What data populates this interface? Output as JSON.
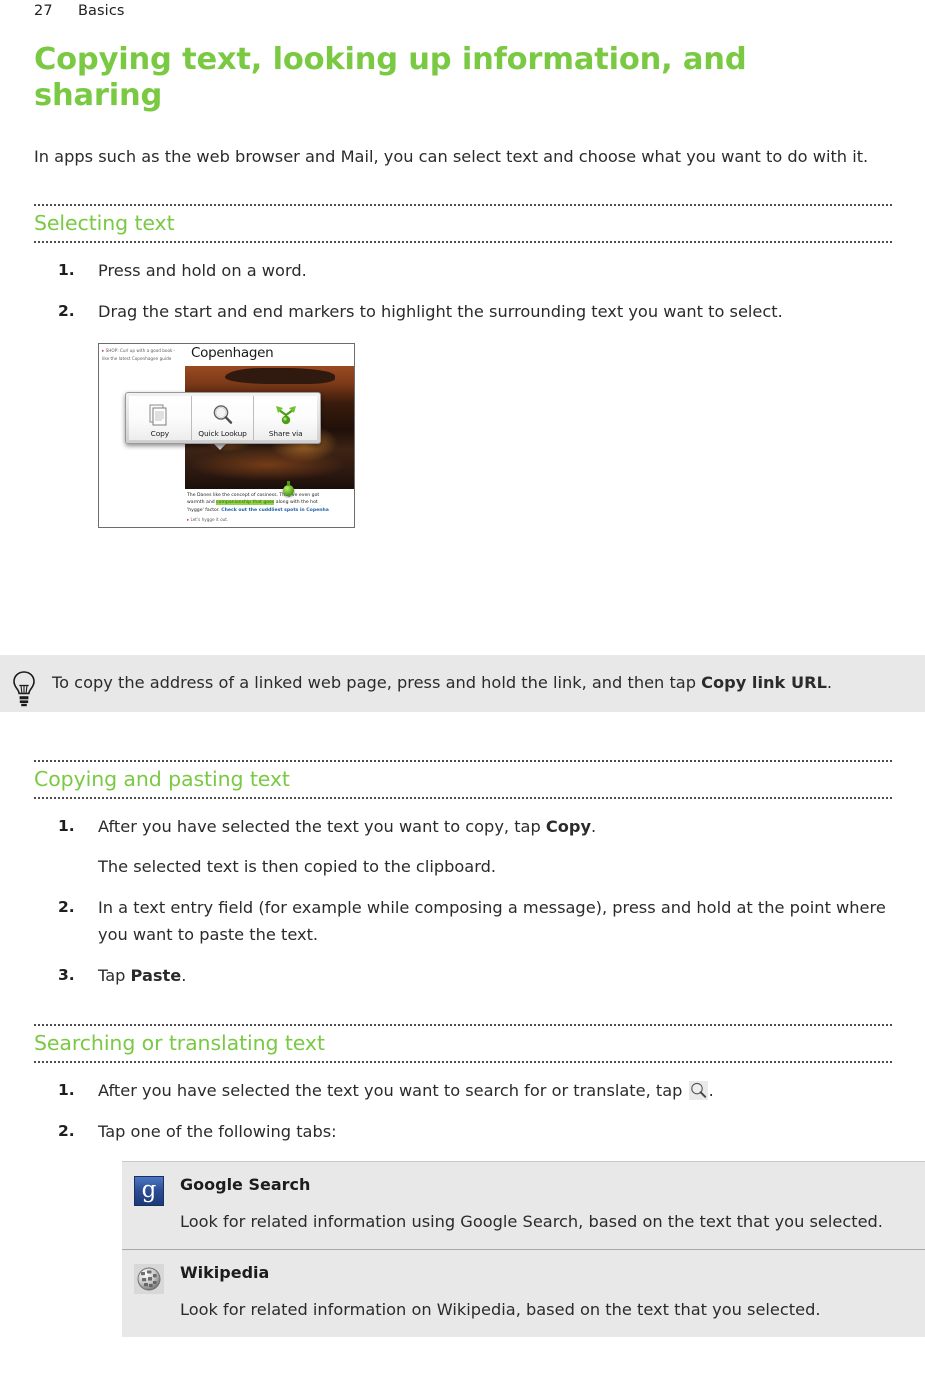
{
  "header": {
    "page_number": "27",
    "section": "Basics"
  },
  "chapter": {
    "title": "Copying text, looking up information, and sharing",
    "intro": "In apps such as the web browser and Mail, you can select text and choose what you want to do with it."
  },
  "sections": [
    {
      "id": "selecting-text",
      "title": "Selecting text",
      "steps": [
        {
          "number": "1.",
          "text": "Press and hold on a word."
        },
        {
          "number": "2.",
          "text": "Drag the start and end markers to highlight the surrounding text you want to select."
        }
      ]
    },
    {
      "id": "copying-pasting",
      "title": "Copying and pasting text",
      "steps": [
        {
          "number": "1.",
          "text_before": "After you have selected the text you want to copy, tap ",
          "bold": "Copy",
          "text_after": ".",
          "sub_note": "The selected text is then copied to the clipboard."
        },
        {
          "number": "2.",
          "text": "In a text entry field (for example while composing a message), press and hold at the point where you want to paste the text."
        },
        {
          "number": "3.",
          "text_before": "Tap ",
          "bold": "Paste",
          "text_after": "."
        }
      ]
    },
    {
      "id": "searching-translating",
      "title": "Searching or translating text",
      "steps": [
        {
          "number": "1.",
          "text_before": "After you have selected the text you want to search for or translate, tap ",
          "icon": "magnifier-icon",
          "text_after": "."
        },
        {
          "number": "2.",
          "text": "Tap one of the following tabs:"
        }
      ]
    }
  ],
  "tip": {
    "icon": "lightbulb-icon",
    "text_before": "To copy the address of a linked web page, press and hold the link, and then tap ",
    "bold": "Copy link URL",
    "text_after": "."
  },
  "figure": {
    "caption_alt": "HTC browser screenshot showing text selection context menu",
    "sidebar_blurb": "SHOP: Curl up with a good book - like the latest Copenhagen guide",
    "page_title": "Copenhagen",
    "menu_items": [
      {
        "label": "Copy",
        "icon": "copy-pages-icon"
      },
      {
        "label": "Quick Lookup",
        "icon": "magnifier-icon"
      },
      {
        "label": "Share via",
        "icon": "share-arrows-icon"
      }
    ],
    "body_line1": "The Danes like the concept of cosiness. They've even got",
    "body_line2_a": "warmth and ",
    "body_line2_hl": "companionship that goes",
    "body_line2_b": " along with the hot",
    "body_line3_a": "'hygge' factor. ",
    "body_line3_link": "Check out the cuddliest spots in Copenha",
    "footer_note": "Let's hygge it out."
  },
  "reference_table": {
    "rows": [
      {
        "icon": "google-logo-icon",
        "name": "Google Search",
        "description": "Look for related information using Google Search, based on the text that you selected."
      },
      {
        "icon": "wikipedia-globe-icon",
        "name": "Wikipedia",
        "description": "Look for related information on Wikipedia, based on the text that you selected."
      }
    ]
  },
  "colors": {
    "accent_green": "#7ac943",
    "callout_bg": "#e8e8e8",
    "body_text": "#2b2b2b",
    "rule": "#4d4d4d"
  }
}
